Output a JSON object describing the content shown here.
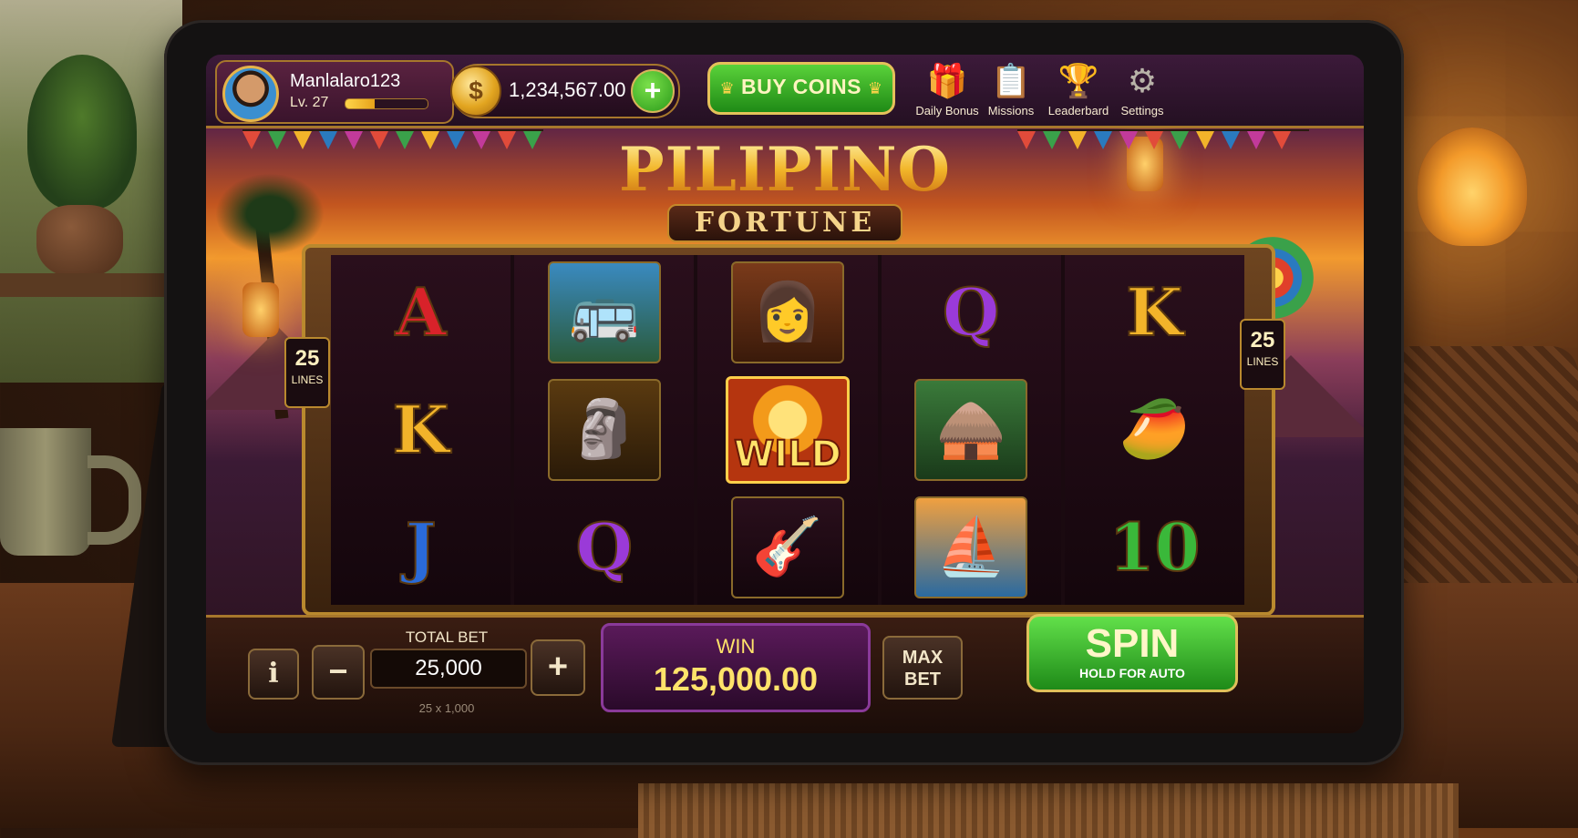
{
  "player": {
    "username": "Manlalaro123",
    "level": "Lv. 27",
    "xp_progress": 0.35
  },
  "wallet": {
    "coin_symbol": "$",
    "balance": "1,234,567.00",
    "add_label": "+"
  },
  "store": {
    "buy_coins_label": "BUY COINS"
  },
  "nav": [
    {
      "label": "Daily Bonus",
      "icon": "gift-icon"
    },
    {
      "label": "Missions",
      "icon": "clipboard-icon"
    },
    {
      "label": "Leaderbard",
      "icon": "trophy-icon"
    },
    {
      "label": "Settings",
      "icon": "gear-icon"
    }
  ],
  "game": {
    "title": "PILIPINO",
    "subtitle": "FORTUNE"
  },
  "paylines": {
    "value": "25",
    "unit": "LINES"
  },
  "reels": [
    [
      {
        "type": "letter",
        "text": "A",
        "color": "#d8222a"
      },
      {
        "type": "letter",
        "text": "K",
        "color": "#f2b42a"
      },
      {
        "type": "letter",
        "text": "J",
        "color": "#2a6ad8"
      }
    ],
    [
      {
        "type": "pic",
        "icon": "jeepney-icon"
      },
      {
        "type": "pic",
        "icon": "golden-statue-icon"
      },
      {
        "type": "letter",
        "text": "Q",
        "color": "#9a3ad8"
      }
    ],
    [
      {
        "type": "pic",
        "icon": "filipina-woman-icon"
      },
      {
        "type": "wild",
        "text": "WILD"
      },
      {
        "type": "pic",
        "icon": "guitar-icon"
      }
    ],
    [
      {
        "type": "letter",
        "text": "Q",
        "color": "#9a3ad8"
      },
      {
        "type": "pic",
        "icon": "nipa-hut-icon"
      },
      {
        "type": "pic",
        "icon": "sailboat-icon"
      }
    ],
    [
      {
        "type": "letter",
        "text": "K",
        "color": "#f2b42a"
      },
      {
        "type": "pic",
        "icon": "mango-icon"
      },
      {
        "type": "letter",
        "text": "10",
        "color": "#3ab83a"
      }
    ]
  ],
  "controls": {
    "info_label": "i",
    "minus_label": "−",
    "plus_label": "+",
    "total_bet_label": "TOTAL BET",
    "total_bet_value": "25,000",
    "bet_formula": "25 x 1,000",
    "win_label": "WIN",
    "win_value": "125,000.00",
    "max_bet_label": "MAX\nBET",
    "spin_label": "SPIN",
    "spin_sub": "HOLD FOR AUTO"
  },
  "colors": {
    "accent_gold": "#e5b44a",
    "spin_green": "#2a9a1a",
    "win_purple": "#5a1a5a"
  }
}
